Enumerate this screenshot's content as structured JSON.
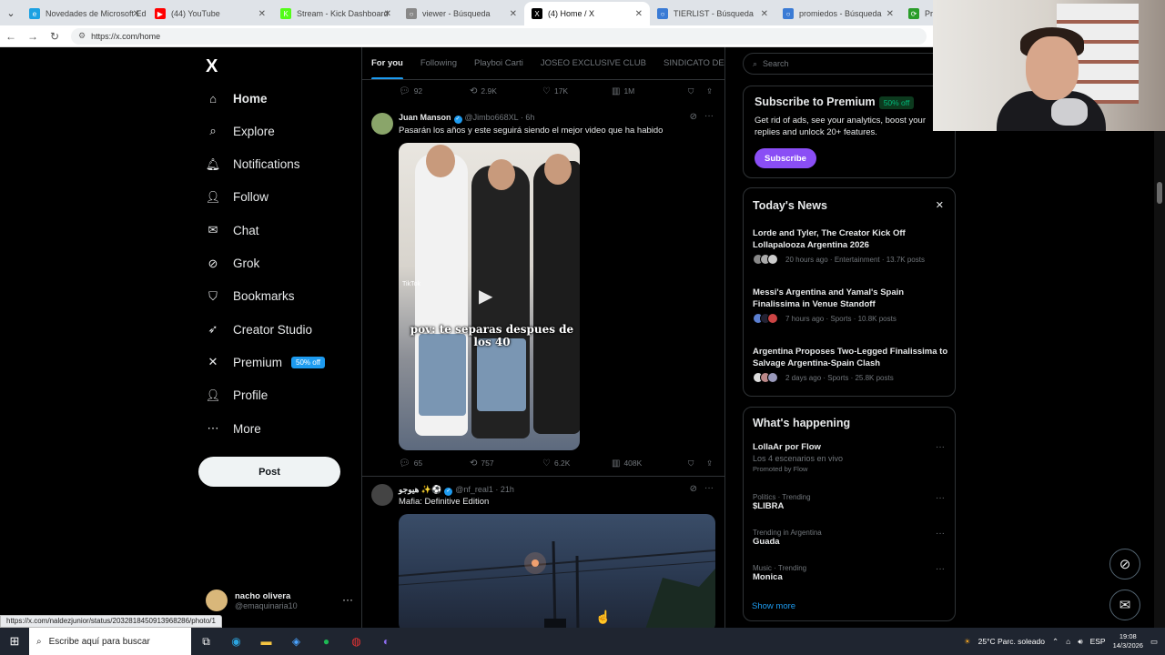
{
  "browser": {
    "tabs": [
      {
        "label": "Novedades de Microsoft Ed",
        "color": "#1ba1e2",
        "glyph": "e"
      },
      {
        "label": "(44) YouTube",
        "color": "#ff0000",
        "glyph": "▶"
      },
      {
        "label": "Stream - Kick Dashboard",
        "color": "#53fc18",
        "glyph": "K"
      },
      {
        "label": "viewer - Búsqueda",
        "color": "#888888",
        "glyph": "○"
      },
      {
        "label": "(4) Home / X",
        "color": "#000000",
        "glyph": "X"
      },
      {
        "label": "TIERLIST - Búsqueda",
        "color": "#3a7bd5",
        "glyph": "○"
      },
      {
        "label": "promiedos - Búsqueda",
        "color": "#3a7bd5",
        "glyph": "○"
      },
      {
        "label": "Pr",
        "color": "#2a9d2a",
        "glyph": "⟳"
      }
    ],
    "url": "https://x.com/home",
    "status_url": "https://x.com/naldezjunior/status/2032818450913968286/photo/1"
  },
  "nav": {
    "logo": "X",
    "items": [
      {
        "label": "Home",
        "icon": "home-icon",
        "glyph": "⌂"
      },
      {
        "label": "Explore",
        "icon": "search-icon",
        "glyph": "⌕"
      },
      {
        "label": "Notifications",
        "icon": "bell-icon",
        "glyph": "🔔︎"
      },
      {
        "label": "Follow",
        "icon": "person-plus-icon",
        "glyph": "👤︎"
      },
      {
        "label": "Chat",
        "icon": "mail-icon",
        "glyph": "✉"
      },
      {
        "label": "Grok",
        "icon": "grok-icon",
        "glyph": "⊘"
      },
      {
        "label": "Bookmarks",
        "icon": "bookmark-icon",
        "glyph": "⛉"
      },
      {
        "label": "Creator Studio",
        "icon": "rocket-icon",
        "glyph": "➶"
      },
      {
        "label": "Premium",
        "icon": "x-icon",
        "glyph": "✕"
      },
      {
        "label": "Profile",
        "icon": "person-icon",
        "glyph": "👤︎"
      },
      {
        "label": "More",
        "icon": "more-circle-icon",
        "glyph": "⋯"
      }
    ],
    "premium_badge": "50% off",
    "post_label": "Post",
    "account": {
      "name": "nacho olivera",
      "handle": "@emaquinaria10"
    }
  },
  "feed": {
    "tabs": [
      "For you",
      "Following",
      "Playboi Carti",
      "JOSEO EXCLUSIVE CLUB",
      "SINDICATO DE C"
    ],
    "top_actions": {
      "replies": "92",
      "reposts": "2.9K",
      "likes": "17K",
      "views": "1M"
    },
    "tweets": [
      {
        "author": "Juan Manson",
        "handle": "@Jimbo668XL",
        "time": "6h",
        "text": "Pasarán los años y este seguirá siendo el mejor video que ha habido",
        "overlay_text": "pov: te separas despues de los 40",
        "watermark": "TikTok",
        "replies": "65",
        "reposts": "757",
        "likes": "6.2K",
        "views": "408K"
      },
      {
        "author": "هيوجو ✨⚽",
        "handle": "@nf_real1",
        "time": "21h",
        "text": "Mafia: Definitive Edition"
      }
    ]
  },
  "sidebar": {
    "search_placeholder": "Search",
    "premium": {
      "title": "Subscribe to Premium",
      "badge": "50% off",
      "body": "Get rid of ads, see your analytics, boost your replies and unlock 20+ features.",
      "button": "Subscribe"
    },
    "news": {
      "title": "Today's News",
      "items": [
        {
          "title": "Lorde and Tyler, The Creator Kick Off Lollapalooza Argentina 2026",
          "meta": "20 hours ago · Entertainment · 13.7K posts"
        },
        {
          "title": "Messi's Argentina and Yamal's Spain Finalissima in Venue Standoff",
          "meta": "7 hours ago · Sports · 10.8K posts"
        },
        {
          "title": "Argentina Proposes Two-Legged Finalissima to Salvage Argentina-Spain Clash",
          "meta": "2 days ago · Sports · 25.8K posts"
        }
      ]
    },
    "happening": {
      "title": "What's happening",
      "items": [
        {
          "category": "",
          "name": "LollaAr por Flow",
          "sub": "Los 4 escenarios en vivo",
          "promo": "Promoted by Flow"
        },
        {
          "category": "Politics · Trending",
          "name": "$LIBRA"
        },
        {
          "category": "Trending in Argentina",
          "name": "Guada"
        },
        {
          "category": "Music · Trending",
          "name": "Monica"
        }
      ],
      "show_more": "Show more"
    }
  },
  "taskbar": {
    "search_placeholder": "Escribe aquí para buscar",
    "weather": "25°C  Parc. soleado",
    "lang": "ESP",
    "time": "19:08",
    "date": "14/3/2026"
  }
}
